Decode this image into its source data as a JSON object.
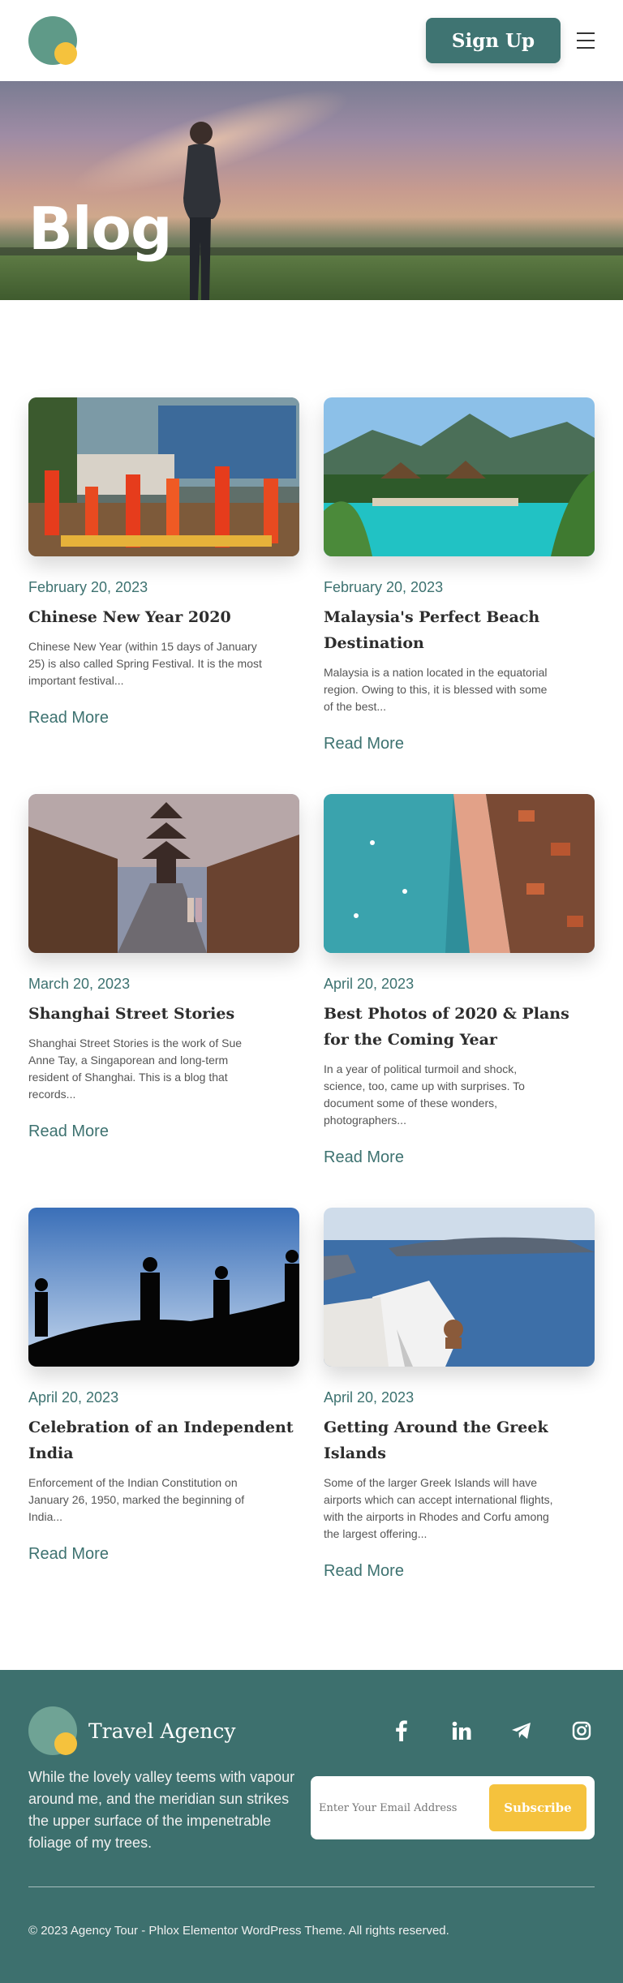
{
  "header": {
    "signup_label": "Sign Up",
    "menu_icon": "hamburger-icon",
    "logo_colors": {
      "primary": "#5f9a88",
      "accent": "#f5c23d"
    }
  },
  "hero": {
    "title": "Blog"
  },
  "posts": [
    {
      "date": "February 20, 2023",
      "title": "Chinese New Year 2020",
      "excerpt": "Chinese New Year (within 15 days of January 25) is also called Spring Festival. It is the most important festival...",
      "read_more": "Read More"
    },
    {
      "date": "February 20, 2023",
      "title": "Malaysia's Perfect Beach Destination",
      "excerpt": "Malaysia is a nation located in the equatorial region. Owing to this, it is blessed with some of the best...",
      "read_more": "Read More"
    },
    {
      "date": "March 20, 2023",
      "title": "Shanghai Street Stories",
      "excerpt": "Shanghai Street Stories is the work of Sue Anne Tay, a Singaporean and long-term resident of Shanghai. This is a blog that records...",
      "read_more": "Read More"
    },
    {
      "date": "April 20, 2023",
      "title": "Best Photos of 2020 & Plans for the Coming Year",
      "excerpt": "In a year of political turmoil and shock, science, too, came up with surprises. To document some of these wonders, photographers...",
      "read_more": "Read More"
    },
    {
      "date": "April 20, 2023",
      "title": "Celebration of an Independent India",
      "excerpt": "Enforcement of the Indian Constitution on January 26, 1950, marked the beginning of India...",
      "read_more": "Read More"
    },
    {
      "date": "April 20, 2023",
      "title": "Getting Around the Greek Islands",
      "excerpt": "Some of the larger Greek Islands will have airports which can accept international flights, with the airports in Rhodes and Corfu among the largest offering...",
      "read_more": "Read More"
    }
  ],
  "footer": {
    "brand": "Travel Agency",
    "description": "While the lovely valley teems with vapour around me, and the meridian sun strikes the upper surface of the impenetrable foliage of my trees.",
    "social_icons": [
      "facebook-icon",
      "linkedin-icon",
      "telegram-icon",
      "instagram-icon"
    ],
    "email_placeholder": "Enter Your Email Address",
    "subscribe_label": "Subscribe",
    "copyright": "© 2023 Agency Tour - Phlox Elementor WordPress Theme. All rights reserved."
  }
}
